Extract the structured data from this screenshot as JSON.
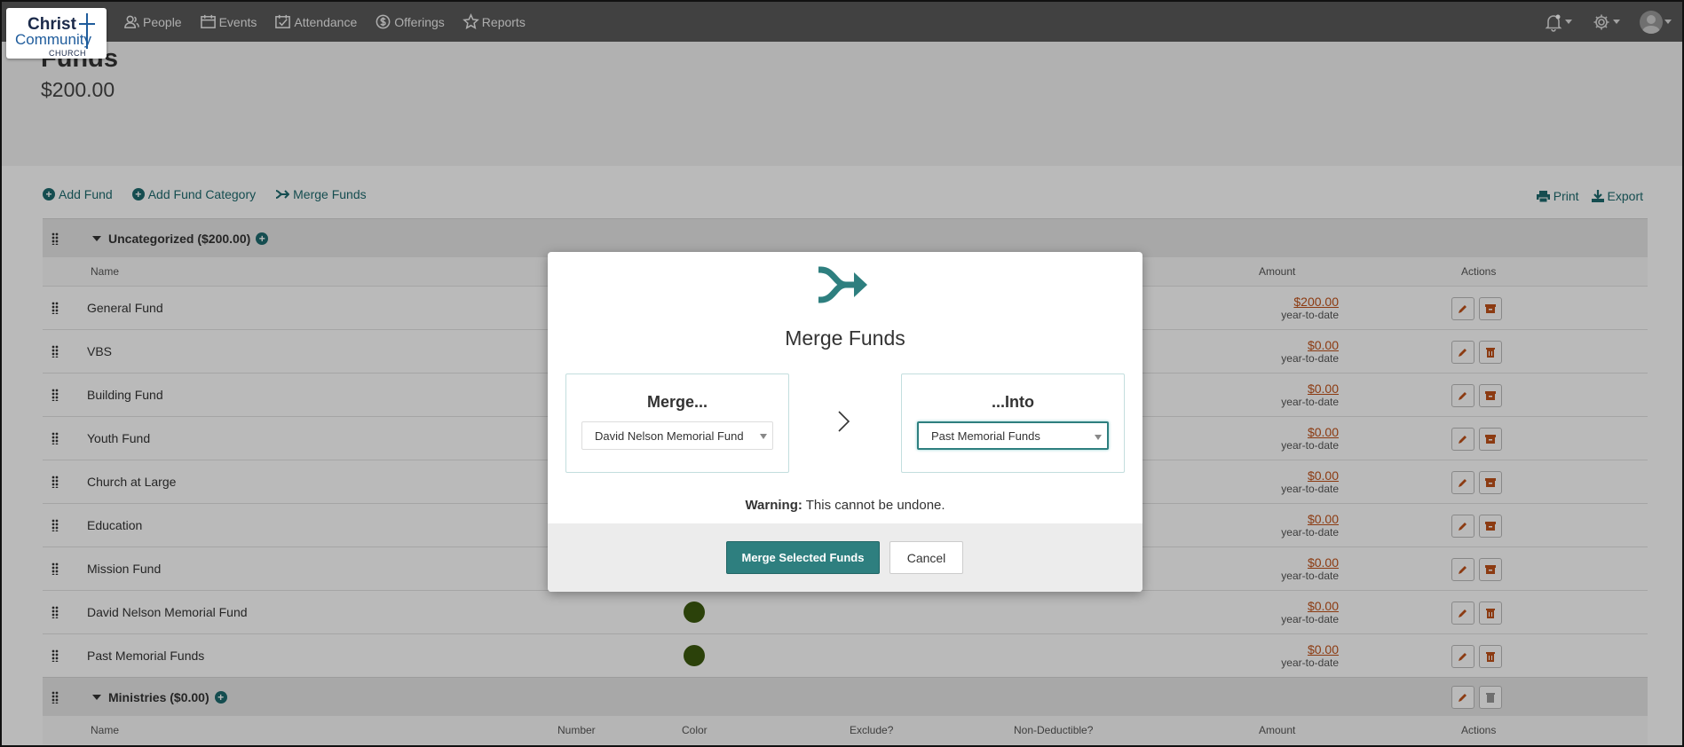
{
  "brand": {
    "line1": "Christ",
    "line2": "Community",
    "line3": "CHURCH"
  },
  "nav": [
    {
      "label": "People",
      "icon": "people-icon"
    },
    {
      "label": "Events",
      "icon": "calendar-icon"
    },
    {
      "label": "Attendance",
      "icon": "check-square-icon"
    },
    {
      "label": "Offerings",
      "icon": "dollar-coin-icon"
    },
    {
      "label": "Reports",
      "icon": "star-icon"
    }
  ],
  "page": {
    "title": "Funds",
    "total": "$200.00"
  },
  "toolbar": {
    "add_fund": "Add Fund",
    "add_category": "Add Fund Category",
    "merge": "Merge Funds",
    "print": "Print",
    "export": "Export"
  },
  "category1": {
    "label": "Uncategorized ($200.00)"
  },
  "headers": {
    "name": "Name",
    "number": "Number",
    "color": "Color",
    "exclude": "Exclude?",
    "non_deductible": "Non-Deductible?",
    "amount": "Amount",
    "actions": "Actions"
  },
  "funds": [
    {
      "name": "General Fund",
      "amount": "$200.00",
      "sub": "year-to-date"
    },
    {
      "name": "VBS",
      "amount": "$0.00",
      "sub": "year-to-date"
    },
    {
      "name": "Building Fund",
      "amount": "$0.00",
      "sub": "year-to-date"
    },
    {
      "name": "Youth Fund",
      "amount": "$0.00",
      "sub": "year-to-date"
    },
    {
      "name": "Church at Large",
      "amount": "$0.00",
      "sub": "year-to-date"
    },
    {
      "name": "Education",
      "amount": "$0.00",
      "sub": "year-to-date"
    },
    {
      "name": "Mission Fund",
      "amount": "$0.00",
      "sub": "year-to-date"
    },
    {
      "name": "David Nelson Memorial Fund",
      "amount": "$0.00",
      "sub": "year-to-date"
    },
    {
      "name": "Past Memorial Funds",
      "amount": "$0.00",
      "sub": "year-to-date"
    }
  ],
  "category2": {
    "label": "Ministries ($0.00)"
  },
  "modal": {
    "title": "Merge Funds",
    "merge_label": "Merge...",
    "into_label": "...Into",
    "from_value": "David Nelson Memorial Fund",
    "to_value": "Past Memorial Funds",
    "warning_strong": "Warning:",
    "warning_text": " This cannot be undone.",
    "confirm": "Merge Selected Funds",
    "cancel": "Cancel"
  },
  "colors": {
    "primary": "#2e7f7f",
    "link": "#1e6a6e",
    "amount": "#c0521a",
    "fund_color": "#3c5a0e",
    "nav_bg": "#595959"
  }
}
